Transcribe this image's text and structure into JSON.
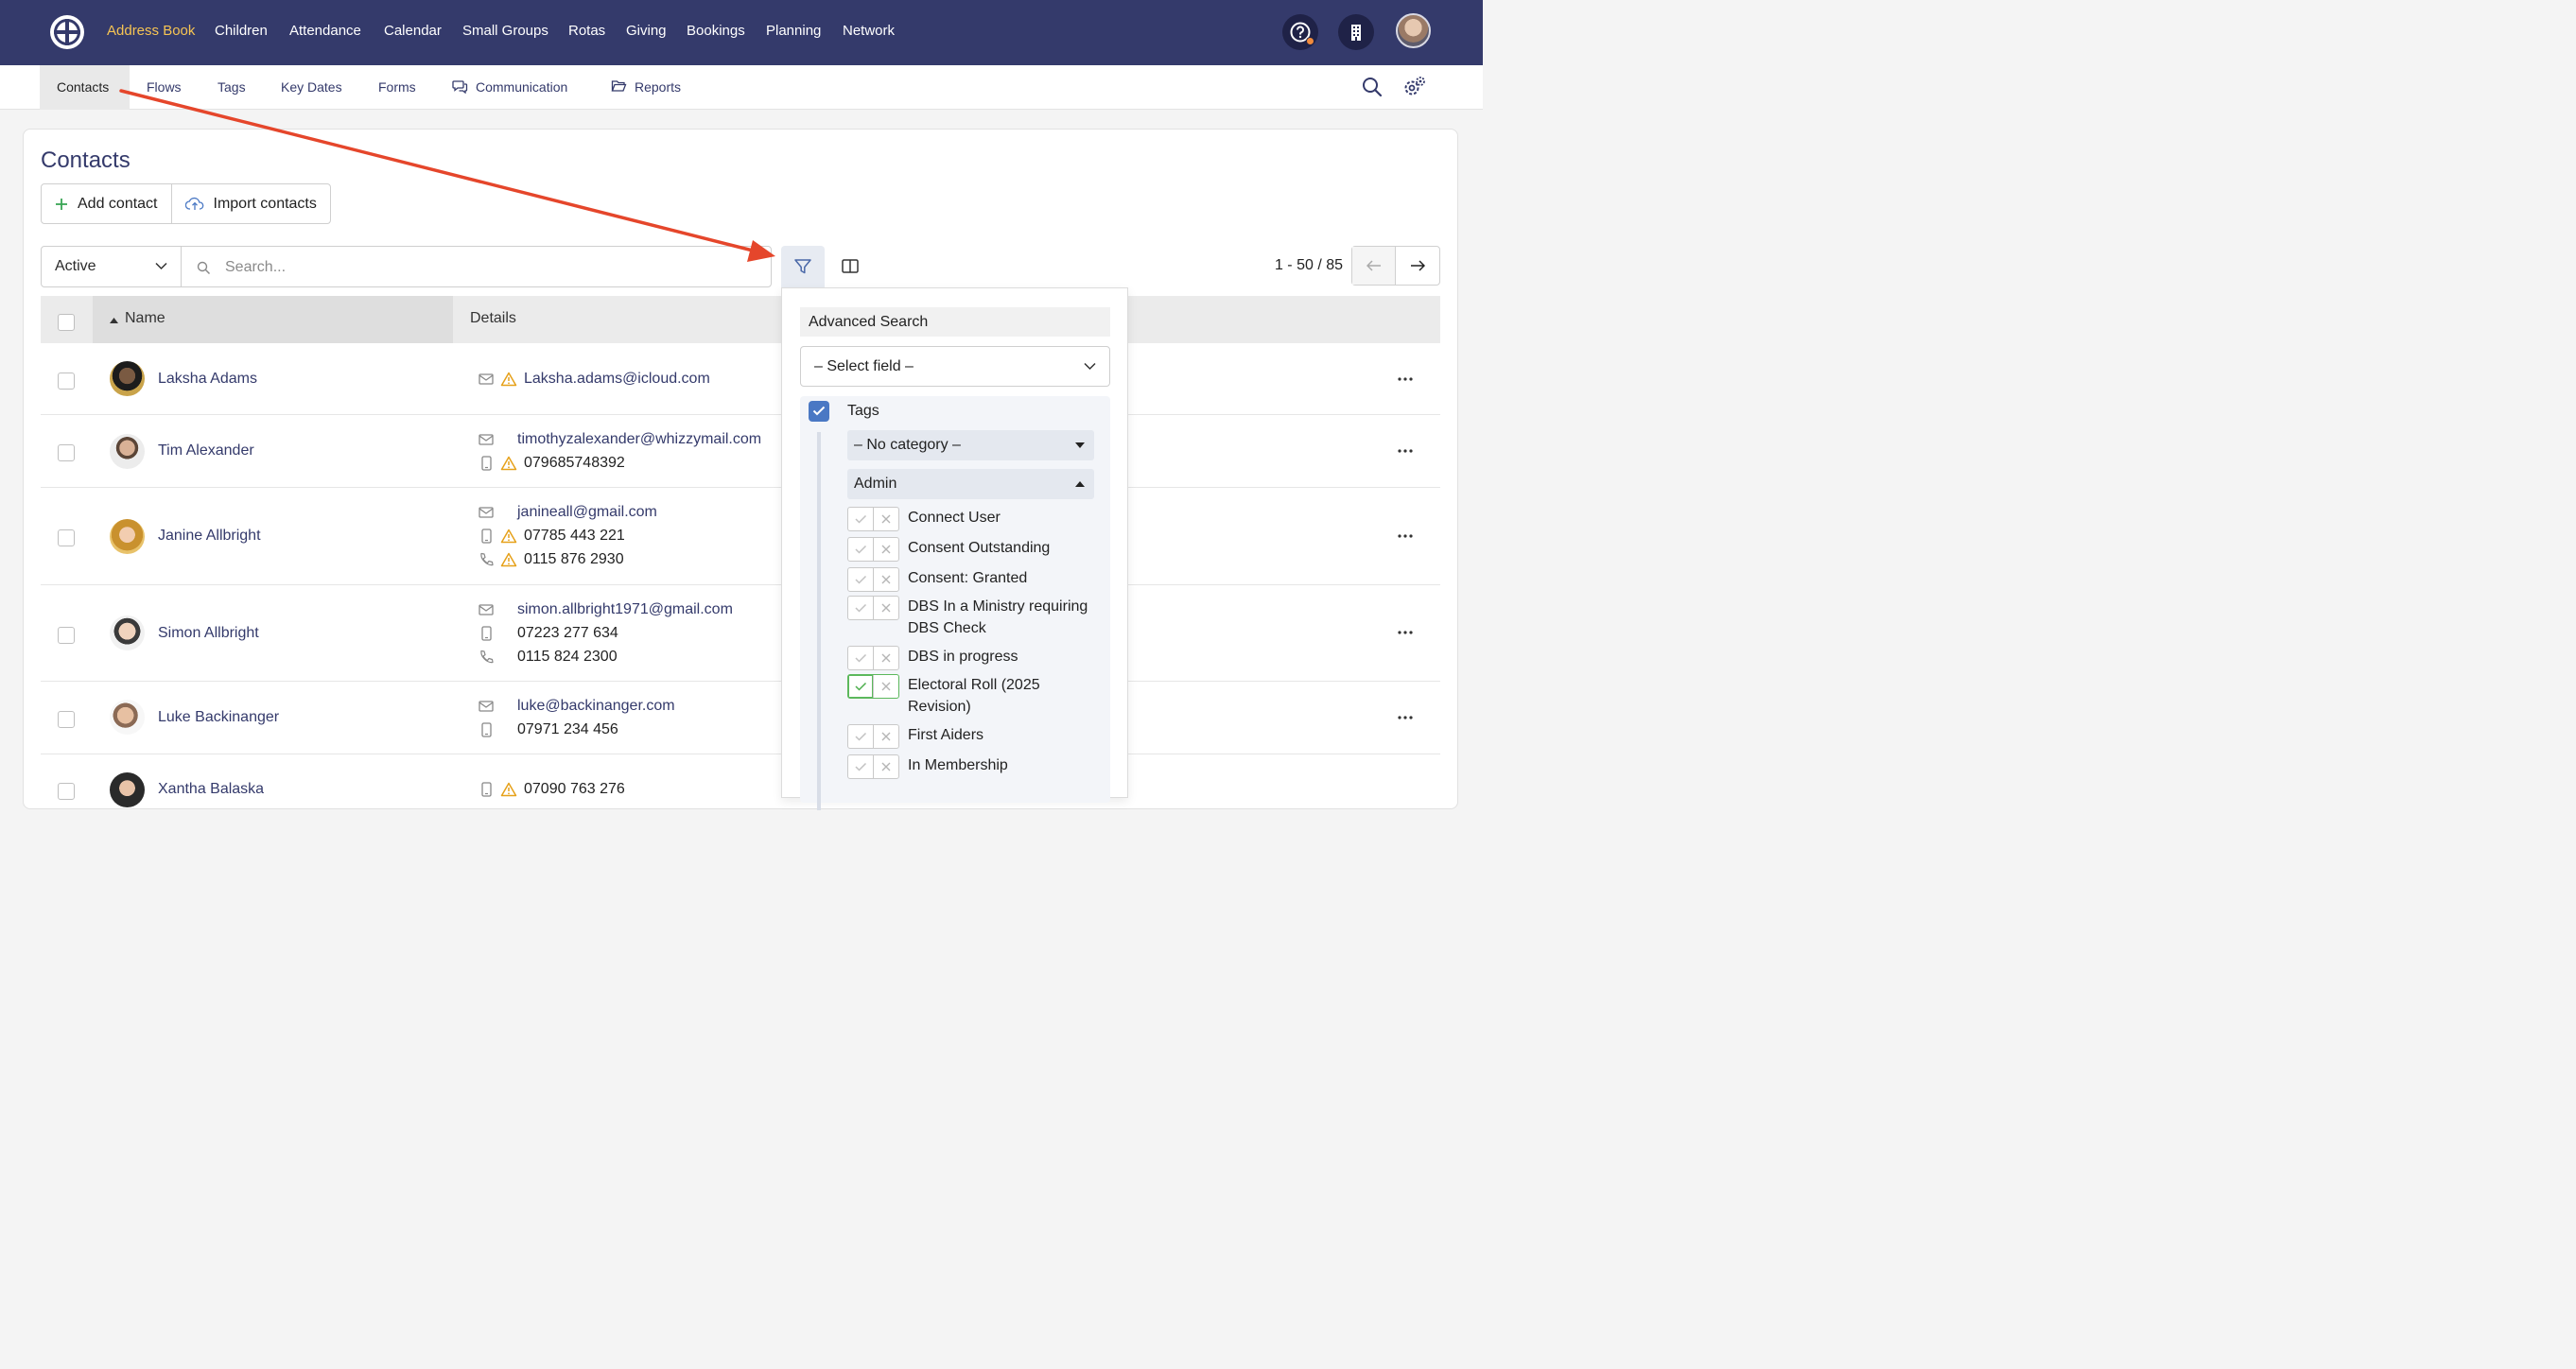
{
  "topnav": {
    "items": [
      {
        "label": "Address Book",
        "active": true
      },
      {
        "label": "Children"
      },
      {
        "label": "Attendance"
      },
      {
        "label": "Calendar"
      },
      {
        "label": "Small Groups"
      },
      {
        "label": "Rotas"
      },
      {
        "label": "Giving"
      },
      {
        "label": "Bookings"
      },
      {
        "label": "Planning"
      },
      {
        "label": "Network"
      }
    ],
    "help_icon": "help-icon",
    "org_icon": "building-icon",
    "active_color": "#f6c453",
    "bar_color": "#343a6b"
  },
  "subnav": {
    "items": [
      {
        "label": "Contacts",
        "active": true
      },
      {
        "label": "Flows"
      },
      {
        "label": "Tags"
      },
      {
        "label": "Key Dates"
      },
      {
        "label": "Forms"
      },
      {
        "label": "Communication",
        "icon": "chat-icon"
      },
      {
        "label": "Reports",
        "icon": "folder-icon"
      }
    ]
  },
  "page": {
    "title": "Contacts",
    "add_contact": "Add contact",
    "import_contacts": "Import contacts",
    "status_filter": "Active",
    "search_placeholder": "Search...",
    "pagination": "1 - 50 / 85"
  },
  "table": {
    "headers": {
      "name": "Name",
      "details": "Details"
    },
    "rows": [
      {
        "name": "Laksha Adams",
        "details": [
          {
            "icon": "mail-icon",
            "text": "Laksha.adams@icloud.com",
            "link": true,
            "warning": true
          }
        ]
      },
      {
        "name": "Tim Alexander",
        "details": [
          {
            "icon": "mail-icon",
            "text": "timothyzalexander@whizzymail.com",
            "link": true,
            "warning": false
          },
          {
            "icon": "mobile-icon",
            "text": "079685748392",
            "link": false,
            "warning": true
          }
        ]
      },
      {
        "name": "Janine Allbright",
        "details": [
          {
            "icon": "mail-icon",
            "text": "janineall@gmail.com",
            "link": true,
            "warning": false
          },
          {
            "icon": "mobile-icon",
            "text": "07785 443 221",
            "link": false,
            "warning": true
          },
          {
            "icon": "phone-icon",
            "text": "0115 876 2930",
            "link": false,
            "warning": true
          }
        ]
      },
      {
        "name": "Simon Allbright",
        "details": [
          {
            "icon": "mail-icon",
            "text": "simon.allbright1971@gmail.com",
            "link": true,
            "warning": false
          },
          {
            "icon": "mobile-icon",
            "text": "07223 277 634",
            "link": false,
            "warning": false
          },
          {
            "icon": "phone-icon",
            "text": "0115 824 2300",
            "link": false,
            "warning": false
          }
        ]
      },
      {
        "name": "Luke Backinanger",
        "details": [
          {
            "icon": "mail-icon",
            "text": "luke@backinanger.com",
            "link": true,
            "warning": false
          },
          {
            "icon": "mobile-icon",
            "text": "07971 234 456",
            "link": false,
            "warning": false
          }
        ]
      },
      {
        "name": "Xantha Balaska",
        "details": [
          {
            "icon": "mobile-icon",
            "text": "07090 763 276",
            "link": false,
            "warning": true
          }
        ]
      }
    ]
  },
  "advanced_search": {
    "title": "Advanced Search",
    "select_field": "– Select field –",
    "tags_label": "Tags",
    "category_no": "– No category –",
    "category_admin": "Admin",
    "tags": [
      {
        "label": "Connect User",
        "state": "none"
      },
      {
        "label": "Consent Outstanding",
        "state": "none"
      },
      {
        "label": "Consent: Granted",
        "state": "none"
      },
      {
        "label": "DBS In a Ministry requiring DBS Check",
        "state": "none"
      },
      {
        "label": "DBS in progress",
        "state": "none"
      },
      {
        "label": "Electoral Roll (2025 Revision)",
        "state": "yes"
      },
      {
        "label": "First Aiders",
        "state": "none"
      },
      {
        "label": "In Membership",
        "state": "none"
      }
    ]
  }
}
